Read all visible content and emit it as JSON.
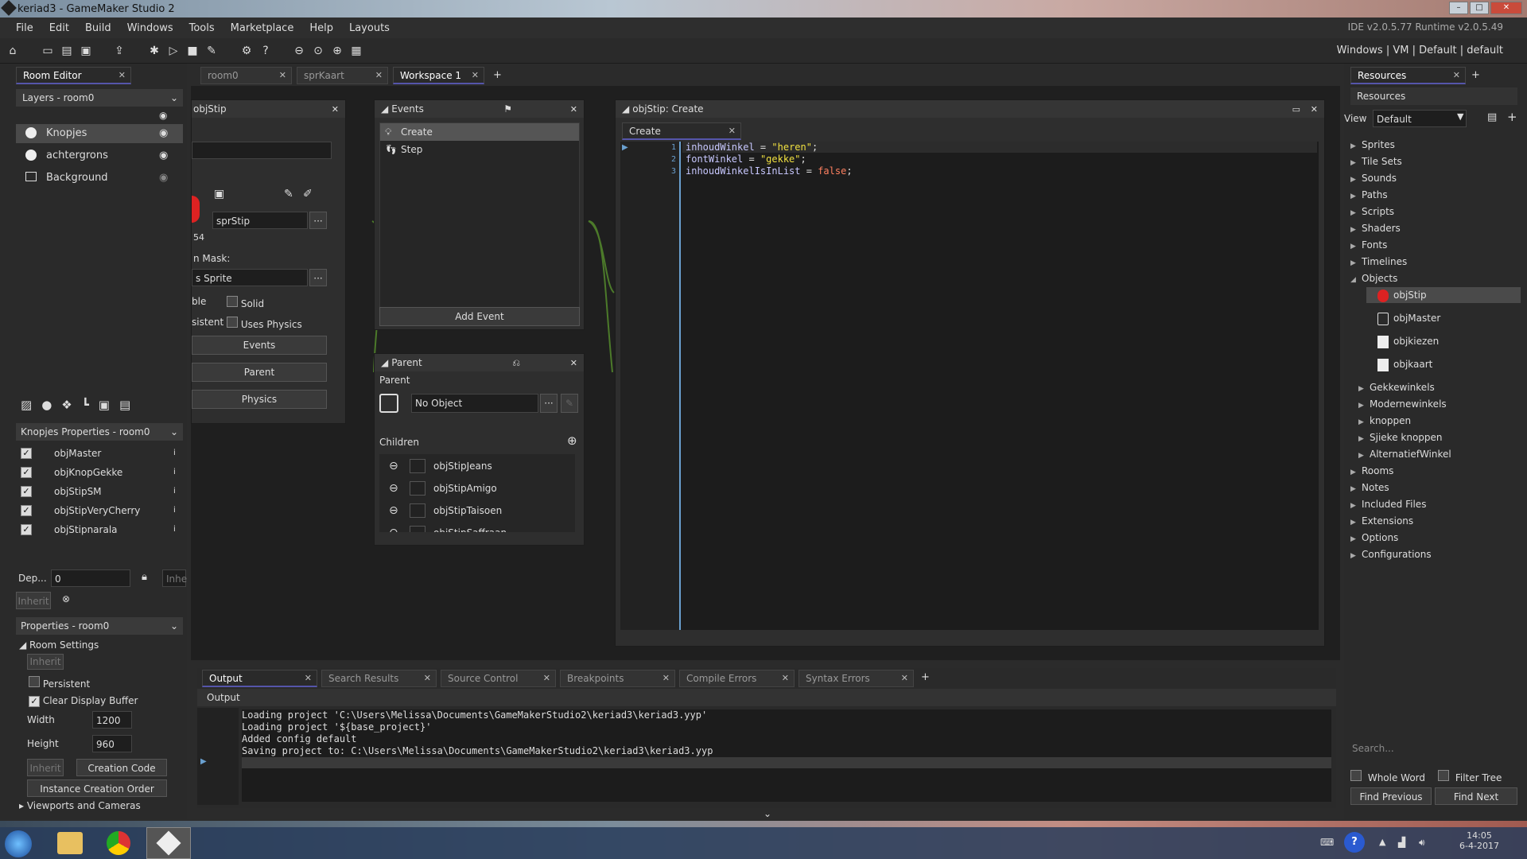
{
  "window": {
    "title": "keriad3 - GameMaker Studio 2",
    "version": "IDE v2.0.5.77  Runtime v2.0.5.49"
  },
  "menu": [
    "File",
    "Edit",
    "Build",
    "Windows",
    "Tools",
    "Marketplace",
    "Help",
    "Layouts"
  ],
  "target": "Windows  |  VM  |  Default  |  default",
  "left_tabs": {
    "room_editor": "Room Editor"
  },
  "workspace_tabs": [
    "room0",
    "sprKaart",
    "Workspace 1"
  ],
  "layers": {
    "header": "Layers - room0",
    "items": [
      "Knopjes",
      "achtergrons",
      "Background"
    ]
  },
  "props_header": "Knopjes Properties - room0",
  "instances": [
    "objMaster",
    "objKnopGekke",
    "objStipSM",
    "objStipVeryCherry",
    "objStipnarala"
  ],
  "depth": {
    "label": "Dep...",
    "value": "0",
    "inherit": "Inherit",
    "inhe": "Inhe"
  },
  "room_props": {
    "header": "Properties - room0",
    "room_settings": "Room Settings",
    "inherit": "Inherit",
    "persistent": "Persistent",
    "clear": "Clear Display Buffer",
    "width_label": "Width",
    "width": "1200",
    "height_label": "Height",
    "height": "960",
    "inherit2": "Inherit",
    "creation_code": "Creation Code",
    "instance_order": "Instance Creation Order",
    "viewports": "Viewports and Cameras"
  },
  "object": {
    "title": "objStip",
    "sprite": "sprStip",
    "sprite_num": "54",
    "mask_label": "n Mask:",
    "mask_value": "s Sprite",
    "visible": "ble",
    "solid": "Solid",
    "persistent": "sistent",
    "uses_physics": "Uses Physics",
    "events_btn": "Events",
    "parent_btn": "Parent",
    "physics_btn": "Physics"
  },
  "events": {
    "title": "Events",
    "items": [
      "Create",
      "Step"
    ],
    "add": "Add Event"
  },
  "parent": {
    "title": "Parent",
    "label": "Parent",
    "value": "No Object",
    "children_label": "Children",
    "children": [
      "objStipJeans",
      "objStipAmigo",
      "objStipTaisoen",
      "objStipSaffraan"
    ]
  },
  "code_editor": {
    "title": "objStip: Create",
    "tab": "Create",
    "lines": [
      {
        "n": "1",
        "code": [
          [
            "var",
            "inhoudWinkel"
          ],
          [
            "op",
            " = "
          ],
          [
            "str",
            "\"heren\""
          ],
          [
            "op",
            ";"
          ]
        ]
      },
      {
        "n": "2",
        "code": [
          [
            "var",
            "fontWinkel"
          ],
          [
            "op",
            " = "
          ],
          [
            "str",
            "\"gekke\""
          ],
          [
            "op",
            ";"
          ]
        ]
      },
      {
        "n": "3",
        "code": [
          [
            "var",
            "inhoudWinkelIsInList"
          ],
          [
            "op",
            " = "
          ],
          [
            "kw",
            "false"
          ],
          [
            "op",
            ";"
          ]
        ]
      }
    ]
  },
  "output": {
    "tabs": [
      "Output",
      "Search Results",
      "Source Control",
      "Breakpoints",
      "Compile Errors",
      "Syntax Errors"
    ],
    "header": "Output",
    "lines": [
      "Loading project 'C:\\Users\\Melissa\\Documents\\GameMakerStudio2\\keriad3\\keriad3.yyp'",
      "Loading project '${base_project}'",
      "Added config default",
      "Saving project to: C:\\Users\\Melissa\\Documents\\GameMakerStudio2\\keriad3\\keriad3.yyp"
    ]
  },
  "resources": {
    "tab": "Resources",
    "header": "Resources",
    "view_label": "View",
    "view_value": "Default",
    "items": [
      "Sprites",
      "Tile Sets",
      "Sounds",
      "Paths",
      "Scripts",
      "Shaders",
      "Fonts",
      "Timelines",
      "Objects"
    ],
    "objects": [
      "objStip",
      "objMaster",
      "objkiezen",
      "objkaart"
    ],
    "groups": [
      "Gekkewinkels",
      "Modernewinkels",
      "knoppen",
      "Sjieke knoppen",
      "AlternatiefWinkel"
    ],
    "after": [
      "Rooms",
      "Notes",
      "Included Files",
      "Extensions",
      "Options",
      "Configurations"
    ],
    "search": "Search...",
    "whole_word": "Whole Word",
    "filter_tree": "Filter Tree",
    "find_prev": "Find Previous",
    "find_next": "Find Next"
  },
  "clock": {
    "time": "14:05",
    "date": "6-4-2017"
  },
  "colors": {
    "var": "#c8c8ff",
    "str": "#f0e040",
    "kw": "#ff8060",
    "accent": "#5e5e8a"
  }
}
